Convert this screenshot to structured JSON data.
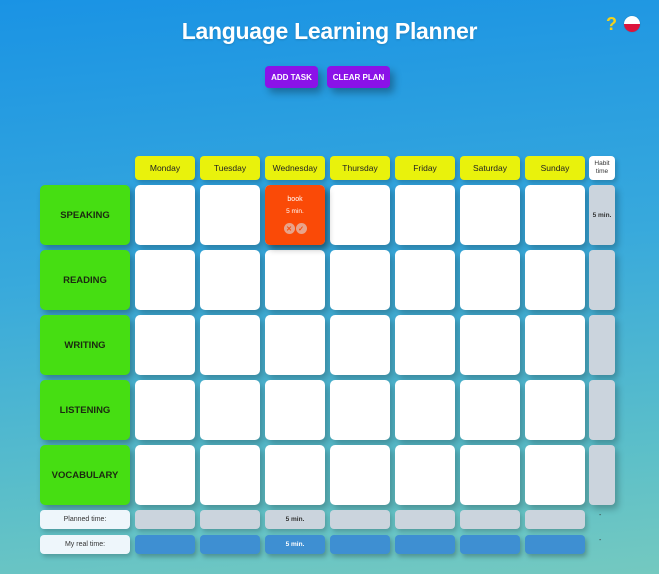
{
  "header": {
    "title": "Language Learning Planner",
    "help_icon": "?",
    "flag_icon": "poland-flag-icon"
  },
  "toolbar": {
    "add_task_label": "ADD TASK",
    "clear_plan_label": "CLEAR PLAN"
  },
  "days": [
    "Monday",
    "Tuesday",
    "Wednesday",
    "Thursday",
    "Friday",
    "Saturday",
    "Sunday"
  ],
  "habit_header": "Habit time",
  "skills": [
    "SPEAKING",
    "READING",
    "WRITING",
    "LISTENING",
    "VOCABULARY"
  ],
  "habit_times": [
    "5 min.",
    "",
    "",
    "",
    ""
  ],
  "task": {
    "skill": "SPEAKING",
    "day": "Wednesday",
    "name": "book",
    "time": "5 min.",
    "delete_icon": "close-circle-icon",
    "done_icon": "check-circle-icon"
  },
  "planned_row": {
    "label": "Planned time:",
    "values": [
      "",
      "",
      "5 min.",
      "",
      "",
      "",
      ""
    ],
    "total": "-"
  },
  "real_row": {
    "label": "My real time:",
    "values": [
      "",
      "",
      "5 min.",
      "",
      "",
      "",
      ""
    ],
    "total": "-"
  },
  "colors": {
    "day_header": "#e9f20c",
    "skill": "#46de12",
    "task": "#fa4a07",
    "button": "#8b12e8",
    "real_time": "#3e8fd2"
  }
}
